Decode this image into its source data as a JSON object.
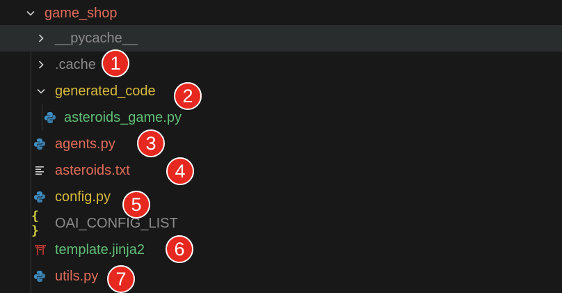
{
  "explorer": {
    "root": {
      "label": "game_shop",
      "color": "#e06c5a"
    },
    "items": [
      {
        "label": "__pycache__",
        "color": "#8a8a8a"
      },
      {
        "label": ".cache",
        "color": "#8a8a8a"
      },
      {
        "label": "generated_code",
        "color": "#d7ba3d"
      },
      {
        "label": "asteroids_game.py",
        "color": "#5fbf76"
      },
      {
        "label": "agents.py",
        "color": "#e06c5a"
      },
      {
        "label": "asteroids.txt",
        "color": "#e06c5a"
      },
      {
        "label": "config.py",
        "color": "#d7ba3d"
      },
      {
        "label": "OAI_CONFIG_LIST",
        "color": "#8a8a8a"
      },
      {
        "label": "template.jinja2",
        "color": "#5fbf76"
      },
      {
        "label": "utils.py",
        "color": "#e06c5a"
      }
    ]
  },
  "badges": [
    "1",
    "2",
    "3",
    "4",
    "5",
    "6",
    "7"
  ],
  "icons": {
    "json": "{ }"
  }
}
